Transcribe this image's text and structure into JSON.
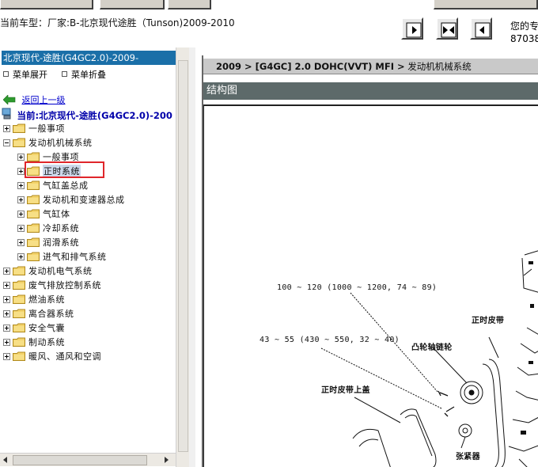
{
  "header": {
    "vehicle_line": "当前车型：厂家:B-北京现代途胜（Tunson)2009-2010",
    "info_line1": "您的专",
    "info_line2": "87038"
  },
  "toolbar": {
    "buttons": [
      {
        "name": "first-page",
        "icon": "arrow-right-icon"
      },
      {
        "name": "fit-page",
        "icon": "arrows-inward-icon"
      },
      {
        "name": "previous-page",
        "icon": "arrow-left-icon"
      }
    ]
  },
  "tree": {
    "header": "北京现代-途胜(G4GC2.0)-2009-",
    "expand_all": "菜单展开",
    "collapse_all": "菜单折叠",
    "back": "返回上一级",
    "current": "当前:北京现代-途胜(G4GC2.0)-200",
    "items": [
      {
        "label": "一般事项",
        "expander": "plus"
      },
      {
        "label": "发动机机械系统",
        "expander": "minus"
      },
      {
        "label": "一般事项",
        "expander": "plus"
      },
      {
        "label": "正时系统",
        "expander": "plus",
        "selected": true
      },
      {
        "label": "气缸盖总成",
        "expander": "plus"
      },
      {
        "label": "发动机和变速器总成",
        "expander": "plus"
      },
      {
        "label": "气缸体",
        "expander": "plus"
      },
      {
        "label": "冷却系统",
        "expander": "plus"
      },
      {
        "label": "润滑系统",
        "expander": "plus"
      },
      {
        "label": "进气和排气系统",
        "expander": "plus"
      },
      {
        "label": "发动机电气系统",
        "expander": "plus"
      },
      {
        "label": "废气排放控制系统",
        "expander": "plus"
      },
      {
        "label": "燃油系统",
        "expander": "plus"
      },
      {
        "label": "离合器系统",
        "expander": "plus"
      },
      {
        "label": "安全气囊",
        "expander": "plus"
      },
      {
        "label": "制动系统",
        "expander": "plus"
      },
      {
        "label": "暖风、通风和空调",
        "expander": "plus"
      }
    ]
  },
  "content": {
    "breadcrumb_bold": "2009 > [G4GC] 2.0 DOHC(VVT) MFI >",
    "breadcrumb_rest": " 发动机机械系统",
    "section_title": "结构图",
    "diagram_labels": {
      "torque1": "100 ~ 120 (1000 ~ 1200, 74 ~ 89)",
      "torque2": "43 ~ 55 (430 ~ 550, 32 ~ 40)",
      "timing_belt": "正时皮带",
      "camshaft_sprocket": "凸轮轴链轮",
      "belt_upper_cover": "正时皮带上盖",
      "tensioner": "张紧器"
    }
  },
  "colors": {
    "tree_header_bg": "#1a6fa8",
    "section_title_bg": "#5d6a6a",
    "highlight_border": "#e0262b",
    "link": "#0000cc"
  }
}
